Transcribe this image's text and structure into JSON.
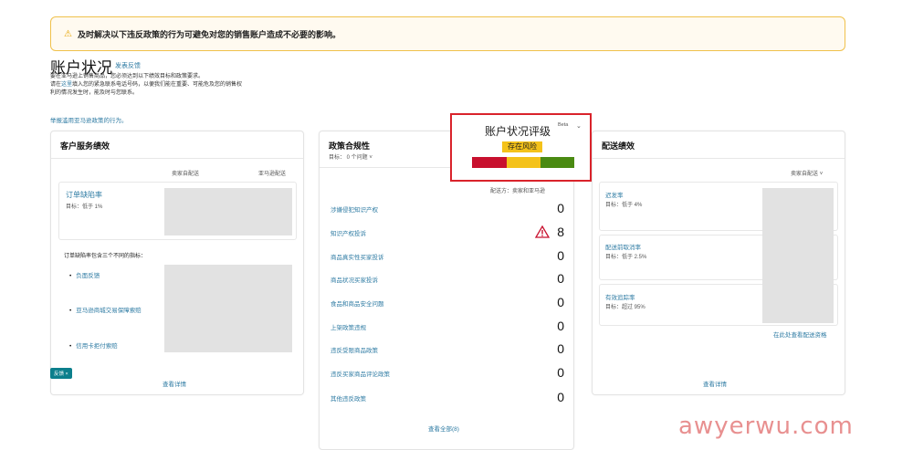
{
  "banner": {
    "icon": "warning-icon",
    "text": "及时解决以下违反政策的行为可避免对您的销售账户造成不必要的影响。"
  },
  "page": {
    "title": "账户状况",
    "feedback_link": "发表反馈",
    "intro_line1": "要在亚马逊上销售商品，您必须达到以下绩效目标和政策要求。",
    "intro_line2_pre": "请在",
    "intro_line2_link": "这里",
    "intro_line2_post": "填入您的紧急联系电话号码，以便我们能在重要、可能危及您的销售权",
    "intro_line3": "利的情况发生时，能及时与您联系。",
    "report_link": "举报滥用亚马逊政策的行为。"
  },
  "customer_service": {
    "title": "客户服务绩效",
    "col1": "卖家自配送",
    "col2": "亚马逊配送",
    "metric_label": "订单缺陷率",
    "metric_target": "目标：低于 1%",
    "desc": "订单缺陷率包含三个不同的指标：",
    "bullets": [
      "负面反馈",
      "亚马逊商城交易保障索赔",
      "信用卡拒付索赔"
    ],
    "tag": "反馈",
    "tag_close": "×",
    "view": "查看详情"
  },
  "policy": {
    "title": "政策合规性",
    "target": "目标： 0 个问题",
    "target_chev": "˅",
    "fulfilled_by": "配送方：卖家和亚马逊",
    "rows": [
      {
        "label": "涉嫌侵犯知识产权",
        "value": "0"
      },
      {
        "label": "知识产权投诉",
        "value": "8"
      },
      {
        "label": "商品真实性买家投诉",
        "value": "0"
      },
      {
        "label": "商品状况买家投诉",
        "value": "0"
      },
      {
        "label": "食品和商品安全问题",
        "value": "0"
      },
      {
        "label": "上架政策违规",
        "value": "0"
      },
      {
        "label": "违反受限商品政策",
        "value": "0"
      },
      {
        "label": "违反买家商品评论政策",
        "value": "0"
      },
      {
        "label": "其他违反政策",
        "value": "0"
      }
    ],
    "view_all": "查看全部(8)"
  },
  "rating": {
    "title": "账户状况评级",
    "beta": "Beta",
    "chevron": "⌄",
    "status": "存在风险",
    "colors": {
      "bad": "#c8102e",
      "mid": "#f4c21a",
      "good": "#4a8a12"
    }
  },
  "shipping": {
    "title": "配送绩效",
    "col": "卖家自配送",
    "col_chev": "˅",
    "metrics": [
      {
        "label": "迟发率",
        "target": "目标：低于 4%"
      },
      {
        "label": "配送前取消率",
        "target": "目标：低于 2.5%"
      },
      {
        "label": "有效追踪率",
        "target": "目标：超过 95%"
      }
    ],
    "shipping_link": "在此处查看配送资格",
    "view": "查看详情"
  },
  "watermark": "awyerwu.com"
}
